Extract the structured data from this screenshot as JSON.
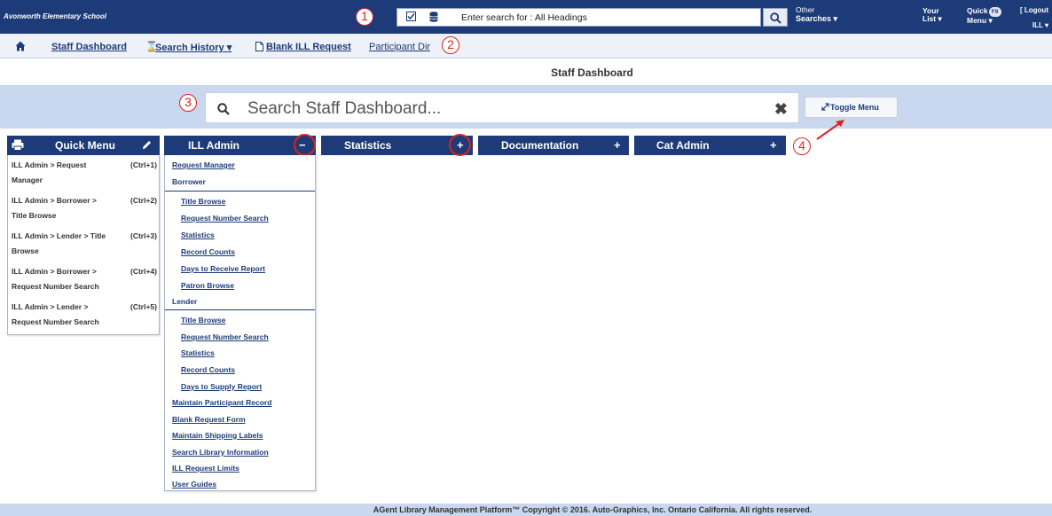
{
  "topbar": {
    "school": "Avonworth Elementary School",
    "search_placeholder": "Enter search for : All Headings",
    "other_searches": {
      "line1": "Other",
      "line2": "Searches ▾"
    },
    "your_list": {
      "line1": "Your",
      "line2": "List ▾"
    },
    "quick_menu": {
      "line1": "Quick",
      "badge": "F9",
      "line2": "Menu ▾"
    },
    "logout": "[ Logout",
    "user": "ILL ▾"
  },
  "annotations": [
    "1",
    "2",
    "3",
    "4"
  ],
  "navbar": {
    "staff_dashboard": "Staff Dashboard",
    "search_history": "Search History ▾",
    "blank_ill": "Blank ILL Request",
    "participant_dir": "Participant Dir"
  },
  "page_title": "Staff Dashboard",
  "staff_search": {
    "placeholder": "Search Staff Dashboard...",
    "clear": "✖"
  },
  "toggle_menu": "Toggle Menu",
  "panels": {
    "quick_menu": "Quick Menu",
    "ill_admin": "ILL Admin",
    "statistics": "Statistics",
    "documentation": "Documentation",
    "cat_admin": "Cat Admin",
    "collapse": "−",
    "expand": "+"
  },
  "quick_menu_items": [
    {
      "line1": "ILL Admin > Request",
      "line2": "Manager",
      "shortcut": "(Ctrl+1)"
    },
    {
      "line1": "ILL Admin > Borrower >",
      "line2": "Title Browse",
      "shortcut": "(Ctrl+2)"
    },
    {
      "line1": "ILL Admin > Lender > Title",
      "line2": "Browse",
      "shortcut": "(Ctrl+3)"
    },
    {
      "line1": "ILL Admin > Borrower >",
      "line2": "Request Number Search",
      "shortcut": "(Ctrl+4)"
    },
    {
      "line1": "ILL Admin > Lender >",
      "line2": "Request Number Search",
      "shortcut": "(Ctrl+5)"
    }
  ],
  "ill_admin": {
    "request_manager": "Request Manager",
    "borrower": "Borrower",
    "borrower_items": [
      "Title Browse",
      "Request Number Search",
      "Statistics",
      "Record Counts",
      "Days to Receive Report",
      "Patron Browse"
    ],
    "lender": "Lender",
    "lender_items": [
      "Title Browse",
      "Request Number Search",
      "Statistics",
      "Record Counts",
      "Days to Supply Report"
    ],
    "other_items": [
      "Maintain Participant Record",
      "Blank Request Form",
      "Maintain Shipping Labels",
      "Search Library Information",
      "ILL Request Limits",
      "User Guides"
    ]
  },
  "footer": "AGent Library Management Platform™ Copyright © 2016. Auto-Graphics, Inc. Ontario California. All rights reserved.",
  "colors": {
    "primary": "#1c3b78",
    "band": "#c9d8ee",
    "annotation": "#d9241c"
  }
}
